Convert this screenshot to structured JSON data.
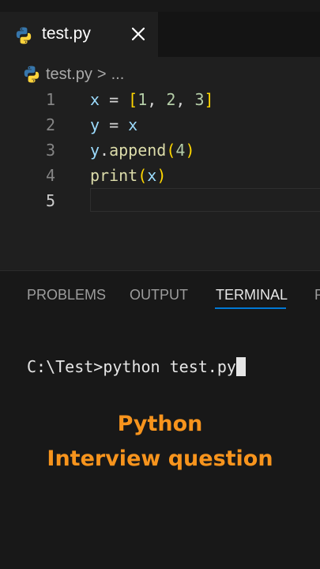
{
  "tab": {
    "filename": "test.py",
    "close_icon": "close-icon"
  },
  "breadcrumb": {
    "filename": "test.py",
    "separator": ">",
    "ellipsis": "..."
  },
  "lines": [
    {
      "number": "1",
      "text": "x = [1, 2, 3]"
    },
    {
      "number": "2",
      "text": "y = x"
    },
    {
      "number": "3",
      "text": "y.append(4)"
    },
    {
      "number": "4",
      "text": "print(x)"
    },
    {
      "number": "5",
      "text": ""
    }
  ],
  "panel": {
    "tabs": [
      "PROBLEMS",
      "OUTPUT",
      "TERMINAL",
      "P"
    ],
    "active_tab": "TERMINAL"
  },
  "terminal": {
    "prompt": "C:\\Test>python test.py"
  },
  "overlay": {
    "line1": "Python",
    "line2": "Interview question"
  },
  "colors": {
    "accent": "#f7941d",
    "tab_underline": "#0078d4",
    "python_blue": "#3776ab",
    "python_yellow": "#ffd43b"
  }
}
